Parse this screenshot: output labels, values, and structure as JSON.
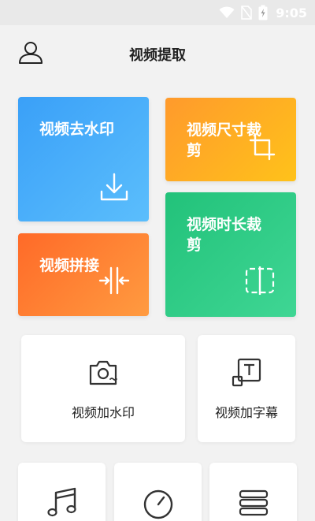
{
  "status_bar": {
    "time": "9:05",
    "icons": [
      "wifi-icon",
      "no-sim-icon",
      "battery-charging-icon"
    ]
  },
  "header": {
    "title": "视频提取",
    "avatar_icon": "user-icon"
  },
  "feature_cards": {
    "watermark_removal": {
      "label": "视频去水印",
      "icon": "download-icon",
      "color": "#3aa0f8"
    },
    "size_crop": {
      "label": "视频尺寸裁剪",
      "icon": "crop-icon",
      "color": "#ffb020"
    },
    "duration_trim": {
      "label": "视频时长裁剪",
      "icon": "split-icon",
      "color": "#22c27a"
    },
    "concat": {
      "label": "视频拼接",
      "icon": "merge-icon",
      "color": "#ff7a30"
    }
  },
  "tool_cards": {
    "add_watermark": {
      "label": "视频加水印",
      "icon": "camera-icon"
    },
    "add_subtitle": {
      "label": "视频加字幕",
      "icon": "text-box-icon"
    },
    "music": {
      "icon": "music-note-icon"
    },
    "speed": {
      "icon": "speedometer-icon"
    },
    "stack": {
      "icon": "book-stack-icon"
    }
  }
}
